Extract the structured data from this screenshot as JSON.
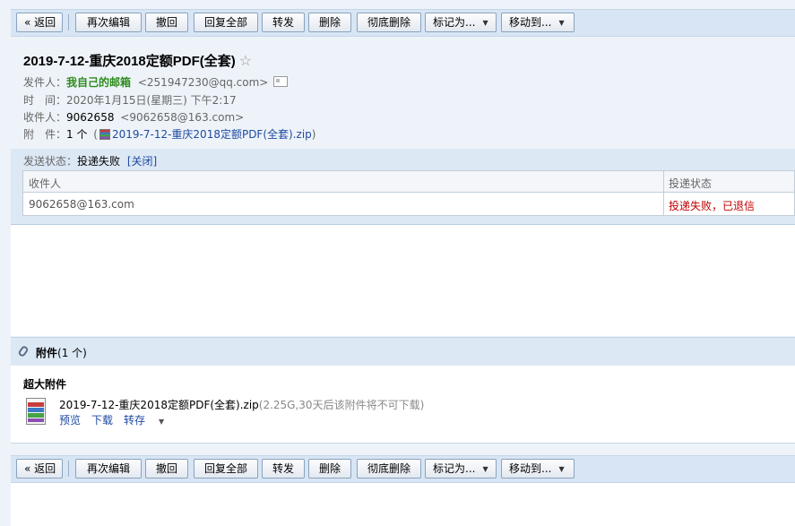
{
  "toolbar": {
    "back": "« 返回",
    "reedit": "再次编辑",
    "recall": "撤回",
    "reply_all": "回复全部",
    "forward": "转发",
    "delete": "删除",
    "delete_permanent": "彻底删除",
    "mark_as": "标记为...",
    "move_to": "移动到..."
  },
  "mail": {
    "subject": "2019-7-12-重庆2018定额PDF(全套)",
    "star": "☆",
    "from_label": "发件人：",
    "from_name": "我自己的邮箱",
    "from_addr": "<251947230@qq.com>",
    "time_label": "时　间：",
    "time_value": "2020年1月15日(星期三) 下午2:17",
    "to_label": "收件人：",
    "to_name": "9062658",
    "to_addr": "<9062658@163.com>",
    "attach_label": "附　件：",
    "attach_count": "1 个",
    "attach_open": "(",
    "attach_name": "2019-7-12-重庆2018定额PDF(全套).zip",
    "attach_close": ")"
  },
  "status": {
    "label": "发送状态：",
    "value": "投递失败",
    "close": "[关闭]",
    "col_recipient": "收件人",
    "col_status": "投递状态",
    "row_recipient": "9062658@163.com",
    "row_status": "投递失败，已退信"
  },
  "attachments": {
    "title": "附件",
    "count": "(1 个)",
    "big_label": "超大附件",
    "file_name": "2019-7-12-重庆2018定额PDF(全套).zip",
    "file_meta": "(2.25G,30天后该附件将不可下载)",
    "preview": "预览",
    "download": "下载",
    "save": "转存"
  }
}
